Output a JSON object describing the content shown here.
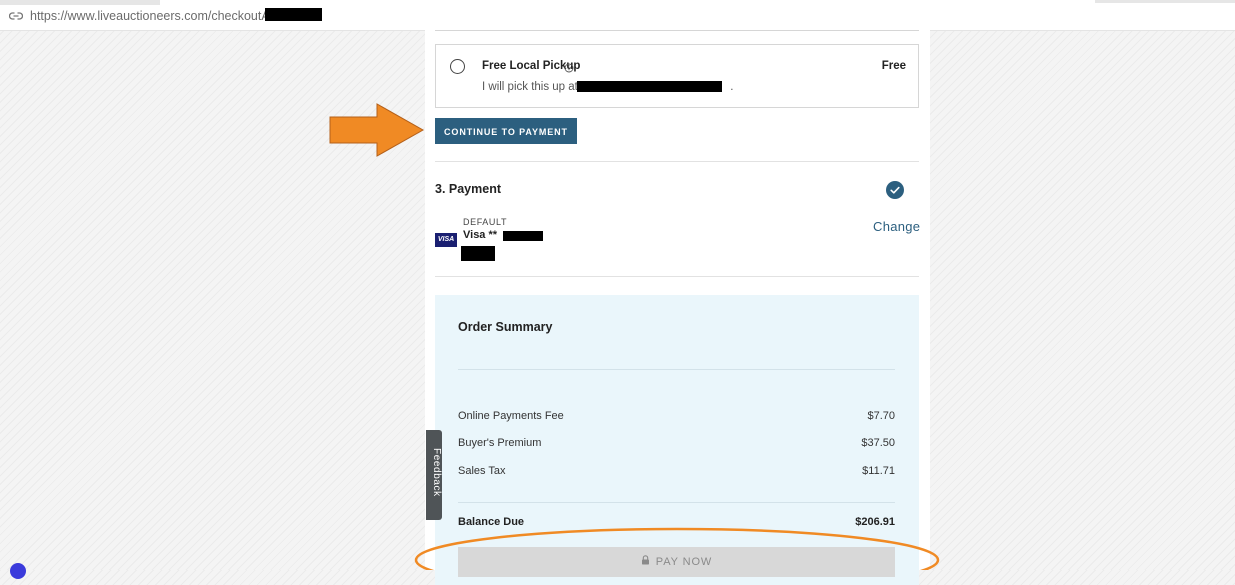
{
  "browser": {
    "url": "https://www.liveauctioneers.com/checkoutATG/"
  },
  "shipping": {
    "option_title": "Free Local Pickup",
    "option_price": "Free",
    "option_desc_prefix": "I will pick this up at",
    "option_desc_suffix": ".",
    "continue_label": "CONTINUE TO PAYMENT"
  },
  "payment": {
    "section_title": "3. Payment",
    "default_label": "DEFAULT",
    "card_brand": "Visa **",
    "visa_logo": "VISA",
    "change_label": "Change"
  },
  "order_summary": {
    "title": "Order Summary",
    "rows": [
      {
        "label": "Online Payments Fee",
        "value": "$7.70"
      },
      {
        "label": "Buyer's Premium",
        "value": "$37.50"
      },
      {
        "label": "Sales Tax",
        "value": "$11.71"
      }
    ],
    "balance_label": "Balance Due",
    "balance_value": "$206.91",
    "pay_now_label": "PAY NOW"
  },
  "feedback": {
    "label": "Feedback"
  },
  "colors": {
    "primary": "#2c5f7f",
    "summary_bg": "#eaf6fb",
    "annotation_orange": "#f08a24"
  },
  "icons": [
    "link-icon",
    "info-icon",
    "check-icon",
    "lock-icon",
    "visa-logo"
  ]
}
